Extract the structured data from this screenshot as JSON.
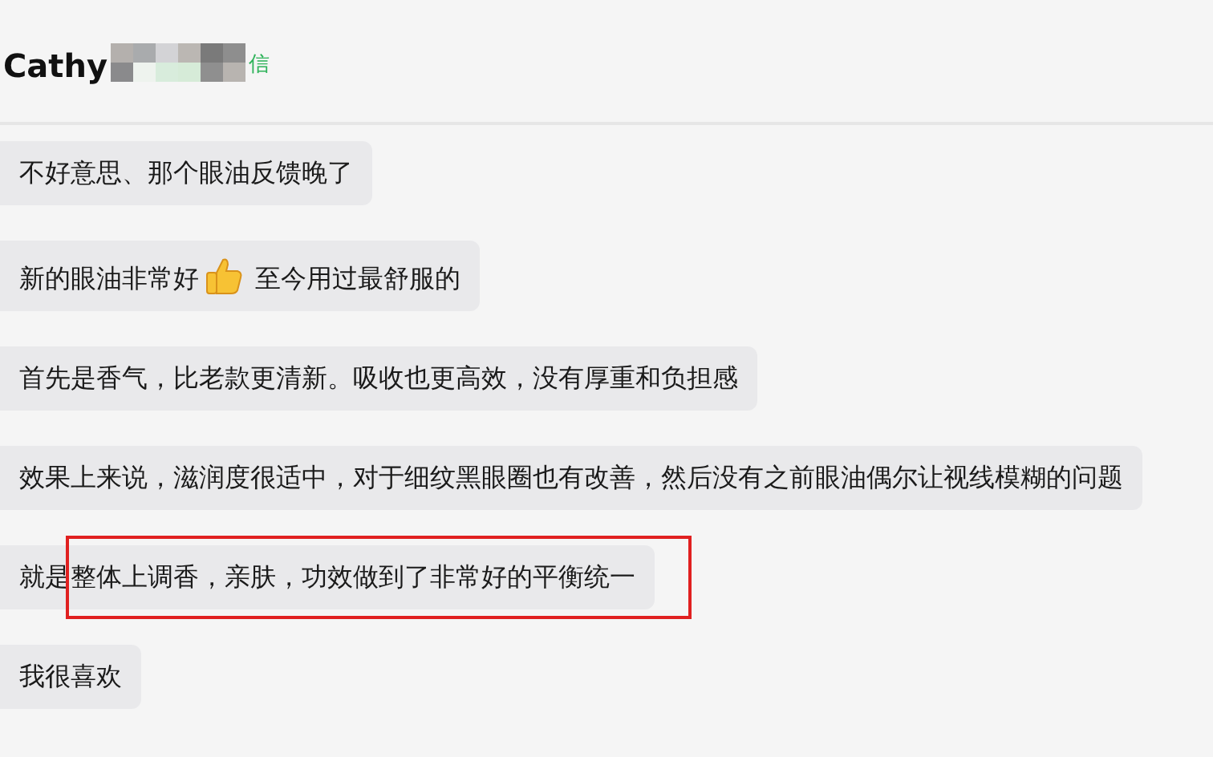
{
  "header": {
    "name": "Cathy",
    "tag": "信"
  },
  "messages": [
    {
      "kind": "text",
      "text": "不好意思、那个眼油反馈晚了",
      "highlighted": false
    },
    {
      "kind": "with-icon",
      "text": "新的眼油非常好",
      "text_after": "至今用过最舒服的",
      "highlighted": false
    },
    {
      "kind": "text",
      "text": "首先是香气，比老款更清新。吸收也更高效，没有厚重和负担感",
      "highlighted": false
    },
    {
      "kind": "text",
      "text": "效果上来说，滋润度很适中，对于细纹黑眼圈也有改善，然后没有之前眼油偶尔让视线模糊的问题",
      "highlighted": false
    },
    {
      "kind": "text",
      "text": "就是整体上调香，亲肤，功效做到了非常好的平衡统一",
      "highlighted": true
    },
    {
      "kind": "text",
      "text": "我很喜欢",
      "highlighted": false
    }
  ]
}
